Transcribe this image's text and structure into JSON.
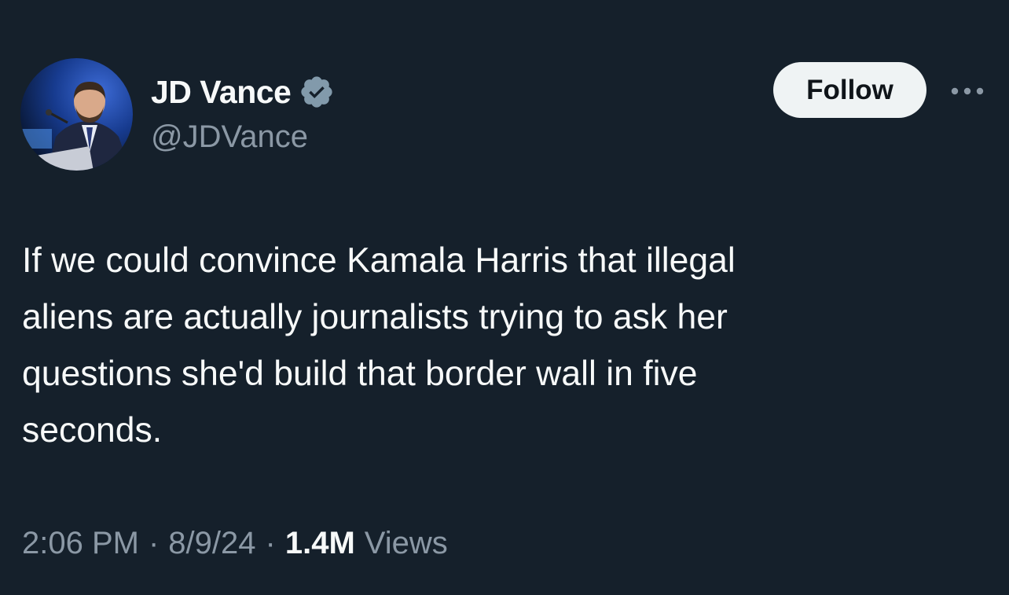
{
  "author": {
    "display_name": "JD Vance",
    "handle": "@JDVance",
    "verified": true,
    "verified_badge_color": "#829aab"
  },
  "actions": {
    "follow_label": "Follow",
    "more_icon": "more-horizontal-icon"
  },
  "tweet": {
    "text": "If we could convince Kamala Harris that illegal\naliens are actually journalists trying to ask her\nquestions she'd build that border wall in five\nseconds."
  },
  "meta": {
    "time": "2:06 PM",
    "separator": "·",
    "date": "8/9/24",
    "views_count": "1.4M",
    "views_label": "Views"
  },
  "colors": {
    "background": "#15202b",
    "primary_text": "#f7f9f9",
    "secondary_text": "#8b98a5",
    "follow_button_bg": "#eff3f4",
    "follow_button_text": "#0f1419"
  }
}
